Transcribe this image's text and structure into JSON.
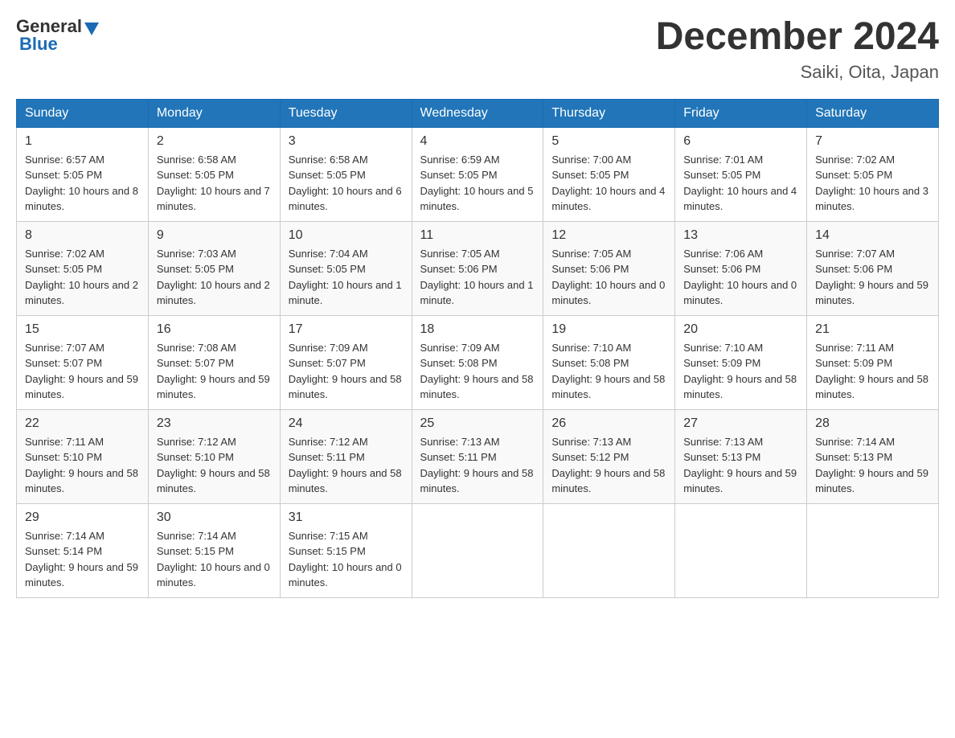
{
  "header": {
    "logo_general": "General",
    "logo_blue": "Blue",
    "month_title": "December 2024",
    "location": "Saiki, Oita, Japan"
  },
  "columns": [
    "Sunday",
    "Monday",
    "Tuesday",
    "Wednesday",
    "Thursday",
    "Friday",
    "Saturday"
  ],
  "weeks": [
    [
      {
        "day": "1",
        "sunrise": "6:57 AM",
        "sunset": "5:05 PM",
        "daylight": "10 hours and 8 minutes."
      },
      {
        "day": "2",
        "sunrise": "6:58 AM",
        "sunset": "5:05 PM",
        "daylight": "10 hours and 7 minutes."
      },
      {
        "day": "3",
        "sunrise": "6:58 AM",
        "sunset": "5:05 PM",
        "daylight": "10 hours and 6 minutes."
      },
      {
        "day": "4",
        "sunrise": "6:59 AM",
        "sunset": "5:05 PM",
        "daylight": "10 hours and 5 minutes."
      },
      {
        "day": "5",
        "sunrise": "7:00 AM",
        "sunset": "5:05 PM",
        "daylight": "10 hours and 4 minutes."
      },
      {
        "day": "6",
        "sunrise": "7:01 AM",
        "sunset": "5:05 PM",
        "daylight": "10 hours and 4 minutes."
      },
      {
        "day": "7",
        "sunrise": "7:02 AM",
        "sunset": "5:05 PM",
        "daylight": "10 hours and 3 minutes."
      }
    ],
    [
      {
        "day": "8",
        "sunrise": "7:02 AM",
        "sunset": "5:05 PM",
        "daylight": "10 hours and 2 minutes."
      },
      {
        "day": "9",
        "sunrise": "7:03 AM",
        "sunset": "5:05 PM",
        "daylight": "10 hours and 2 minutes."
      },
      {
        "day": "10",
        "sunrise": "7:04 AM",
        "sunset": "5:05 PM",
        "daylight": "10 hours and 1 minute."
      },
      {
        "day": "11",
        "sunrise": "7:05 AM",
        "sunset": "5:06 PM",
        "daylight": "10 hours and 1 minute."
      },
      {
        "day": "12",
        "sunrise": "7:05 AM",
        "sunset": "5:06 PM",
        "daylight": "10 hours and 0 minutes."
      },
      {
        "day": "13",
        "sunrise": "7:06 AM",
        "sunset": "5:06 PM",
        "daylight": "10 hours and 0 minutes."
      },
      {
        "day": "14",
        "sunrise": "7:07 AM",
        "sunset": "5:06 PM",
        "daylight": "9 hours and 59 minutes."
      }
    ],
    [
      {
        "day": "15",
        "sunrise": "7:07 AM",
        "sunset": "5:07 PM",
        "daylight": "9 hours and 59 minutes."
      },
      {
        "day": "16",
        "sunrise": "7:08 AM",
        "sunset": "5:07 PM",
        "daylight": "9 hours and 59 minutes."
      },
      {
        "day": "17",
        "sunrise": "7:09 AM",
        "sunset": "5:07 PM",
        "daylight": "9 hours and 58 minutes."
      },
      {
        "day": "18",
        "sunrise": "7:09 AM",
        "sunset": "5:08 PM",
        "daylight": "9 hours and 58 minutes."
      },
      {
        "day": "19",
        "sunrise": "7:10 AM",
        "sunset": "5:08 PM",
        "daylight": "9 hours and 58 minutes."
      },
      {
        "day": "20",
        "sunrise": "7:10 AM",
        "sunset": "5:09 PM",
        "daylight": "9 hours and 58 minutes."
      },
      {
        "day": "21",
        "sunrise": "7:11 AM",
        "sunset": "5:09 PM",
        "daylight": "9 hours and 58 minutes."
      }
    ],
    [
      {
        "day": "22",
        "sunrise": "7:11 AM",
        "sunset": "5:10 PM",
        "daylight": "9 hours and 58 minutes."
      },
      {
        "day": "23",
        "sunrise": "7:12 AM",
        "sunset": "5:10 PM",
        "daylight": "9 hours and 58 minutes."
      },
      {
        "day": "24",
        "sunrise": "7:12 AM",
        "sunset": "5:11 PM",
        "daylight": "9 hours and 58 minutes."
      },
      {
        "day": "25",
        "sunrise": "7:13 AM",
        "sunset": "5:11 PM",
        "daylight": "9 hours and 58 minutes."
      },
      {
        "day": "26",
        "sunrise": "7:13 AM",
        "sunset": "5:12 PM",
        "daylight": "9 hours and 58 minutes."
      },
      {
        "day": "27",
        "sunrise": "7:13 AM",
        "sunset": "5:13 PM",
        "daylight": "9 hours and 59 minutes."
      },
      {
        "day": "28",
        "sunrise": "7:14 AM",
        "sunset": "5:13 PM",
        "daylight": "9 hours and 59 minutes."
      }
    ],
    [
      {
        "day": "29",
        "sunrise": "7:14 AM",
        "sunset": "5:14 PM",
        "daylight": "9 hours and 59 minutes."
      },
      {
        "day": "30",
        "sunrise": "7:14 AM",
        "sunset": "5:15 PM",
        "daylight": "10 hours and 0 minutes."
      },
      {
        "day": "31",
        "sunrise": "7:15 AM",
        "sunset": "5:15 PM",
        "daylight": "10 hours and 0 minutes."
      },
      null,
      null,
      null,
      null
    ]
  ]
}
